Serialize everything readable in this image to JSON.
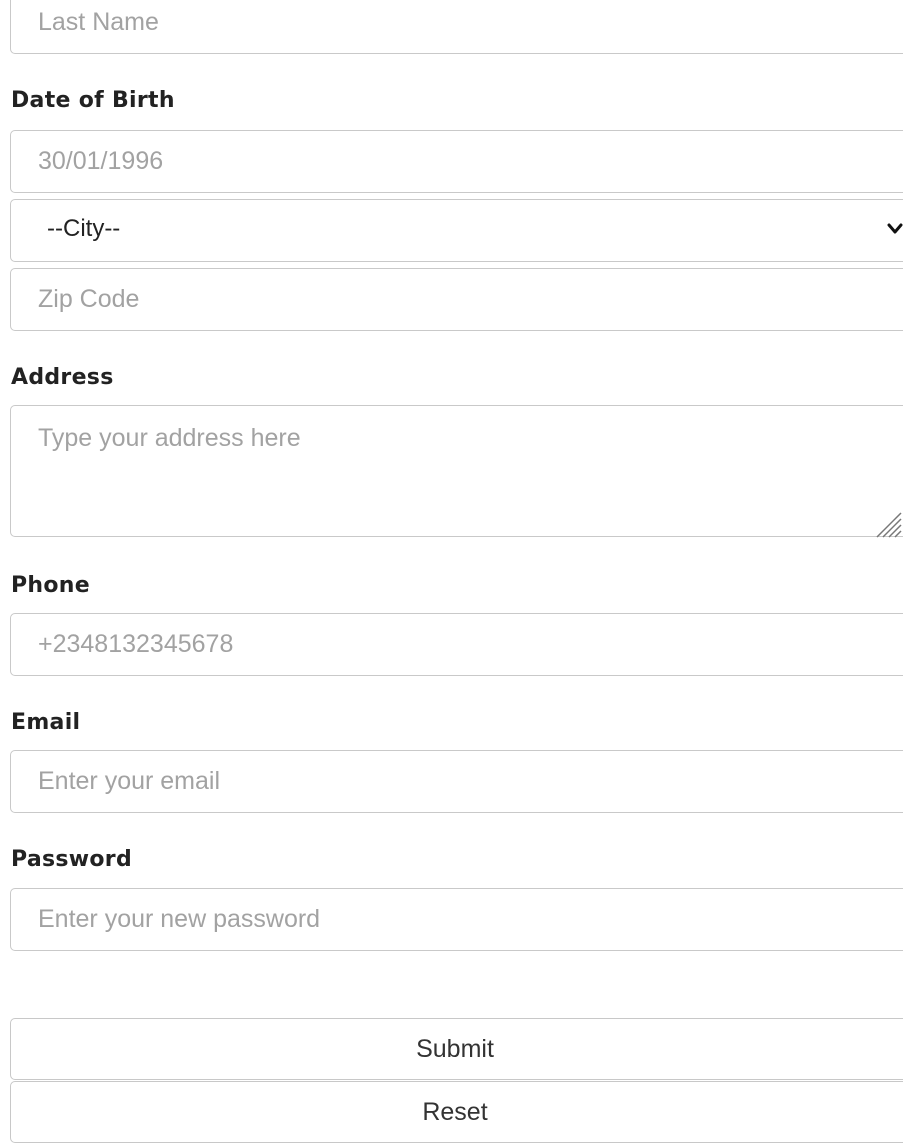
{
  "form": {
    "last_name": {
      "placeholder": "Last Name"
    },
    "dob": {
      "label": "Date of Birth",
      "placeholder": "30/01/1996"
    },
    "city": {
      "selected": "--City--",
      "icon": "chevron-down-icon"
    },
    "zip": {
      "placeholder": "Zip Code"
    },
    "address": {
      "label": "Address",
      "placeholder": "Type your address here"
    },
    "phone": {
      "label": "Phone",
      "placeholder": "+2348132345678"
    },
    "email": {
      "label": "Email",
      "placeholder": "Enter your email"
    },
    "password": {
      "label": "Password",
      "placeholder": "Enter your new password"
    },
    "submit_label": "Submit",
    "reset_label": "Reset"
  }
}
